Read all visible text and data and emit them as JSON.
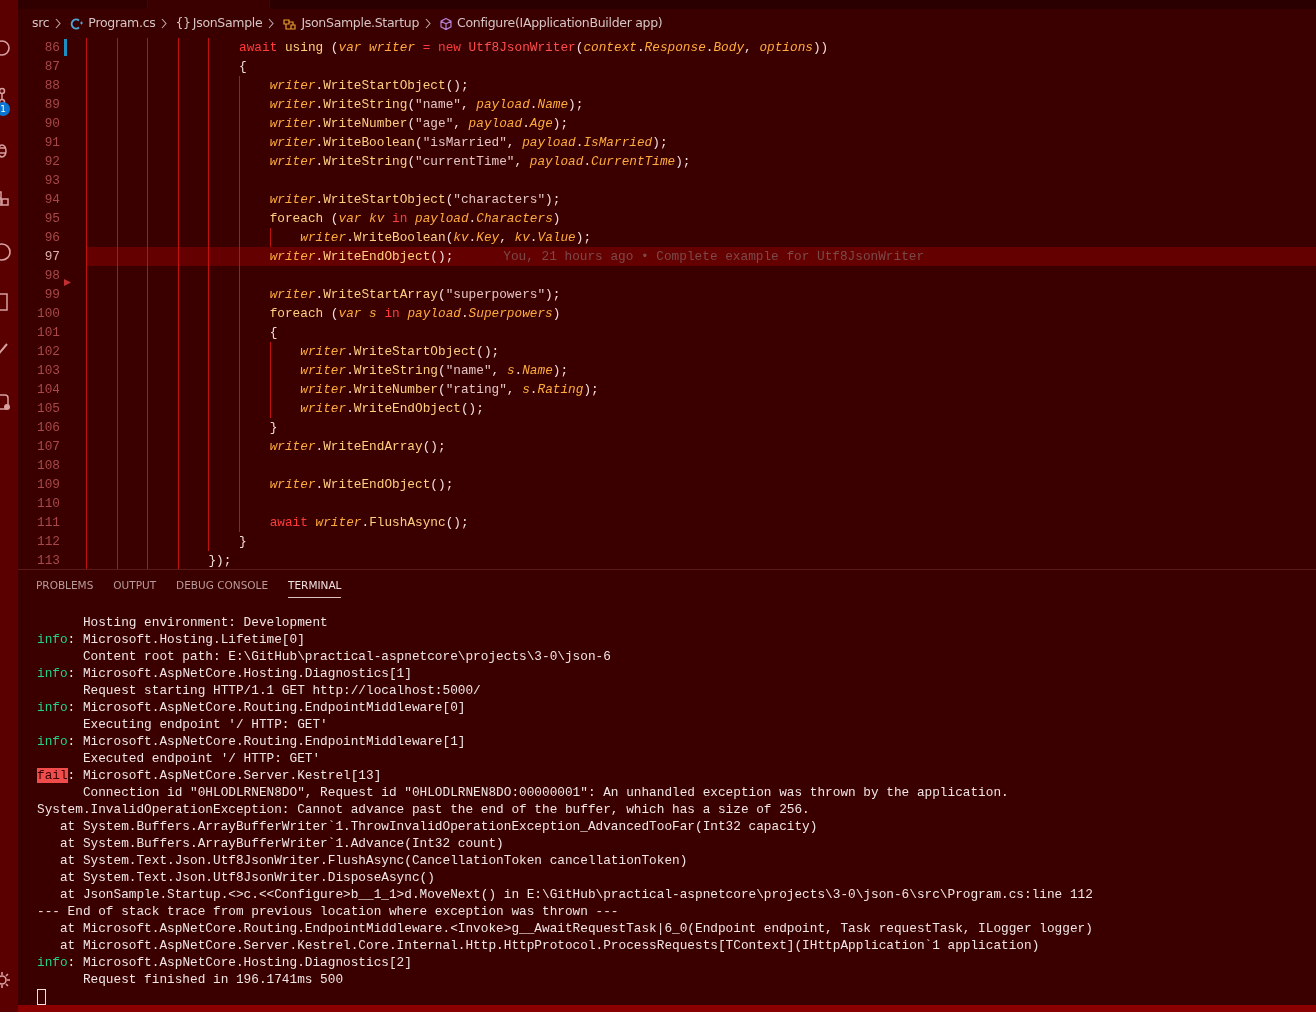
{
  "activity_bar": {
    "badge": "1"
  },
  "breadcrumb": [
    {
      "kind": "folder",
      "label": "src"
    },
    {
      "kind": "csharp",
      "label": "Program.cs"
    },
    {
      "kind": "namespace",
      "symbol": "{}",
      "label": "JsonSample"
    },
    {
      "kind": "class",
      "label": "JsonSample.Startup"
    },
    {
      "kind": "method",
      "label": "Configure(IApplicationBuilder app)"
    }
  ],
  "editor": {
    "lines": [
      {
        "number": "86",
        "modified": true,
        "current": false,
        "tokens": [
          {
            "kind": "kw",
            "text": "                    await "
          },
          {
            "kind": "ctl",
            "text": "using"
          },
          {
            "kind": "p",
            "text": " ("
          },
          {
            "kind": "var",
            "text": "var writer"
          },
          {
            "kind": "kw",
            "text": " = new "
          },
          {
            "kind": "type",
            "text": "Utf8JsonWriter"
          },
          {
            "kind": "p",
            "text": "("
          },
          {
            "kind": "var",
            "text": "context"
          },
          {
            "kind": "p",
            "text": "."
          },
          {
            "kind": "var",
            "text": "Response"
          },
          {
            "kind": "p",
            "text": "."
          },
          {
            "kind": "var",
            "text": "Body"
          },
          {
            "kind": "p",
            "text": ", "
          },
          {
            "kind": "var",
            "text": "options"
          },
          {
            "kind": "p",
            "text": "))"
          }
        ]
      },
      {
        "number": "87",
        "modified": false,
        "current": false,
        "tokens": [
          {
            "kind": "p",
            "text": "                    {"
          }
        ]
      },
      {
        "number": "88",
        "modified": false,
        "current": false,
        "tokens": [
          {
            "kind": "var",
            "text": "                        writer"
          },
          {
            "kind": "p",
            "text": "."
          },
          {
            "kind": "fn",
            "text": "WriteStartObject"
          },
          {
            "kind": "p",
            "text": "();"
          }
        ]
      },
      {
        "number": "89",
        "modified": false,
        "current": false,
        "tokens": [
          {
            "kind": "var",
            "text": "                        writer"
          },
          {
            "kind": "p",
            "text": "."
          },
          {
            "kind": "fn",
            "text": "WriteString"
          },
          {
            "kind": "p",
            "text": "("
          },
          {
            "kind": "str",
            "text": "\"name\""
          },
          {
            "kind": "p",
            "text": ", "
          },
          {
            "kind": "var",
            "text": "payload"
          },
          {
            "kind": "p",
            "text": "."
          },
          {
            "kind": "var",
            "text": "Name"
          },
          {
            "kind": "p",
            "text": ");"
          }
        ]
      },
      {
        "number": "90",
        "modified": false,
        "current": false,
        "tokens": [
          {
            "kind": "var",
            "text": "                        writer"
          },
          {
            "kind": "p",
            "text": "."
          },
          {
            "kind": "fn",
            "text": "WriteNumber"
          },
          {
            "kind": "p",
            "text": "("
          },
          {
            "kind": "str",
            "text": "\"age\""
          },
          {
            "kind": "p",
            "text": ", "
          },
          {
            "kind": "var",
            "text": "payload"
          },
          {
            "kind": "p",
            "text": "."
          },
          {
            "kind": "var",
            "text": "Age"
          },
          {
            "kind": "p",
            "text": ");"
          }
        ]
      },
      {
        "number": "91",
        "modified": false,
        "current": false,
        "tokens": [
          {
            "kind": "var",
            "text": "                        writer"
          },
          {
            "kind": "p",
            "text": "."
          },
          {
            "kind": "fn",
            "text": "WriteBoolean"
          },
          {
            "kind": "p",
            "text": "("
          },
          {
            "kind": "str",
            "text": "\"isMarried\""
          },
          {
            "kind": "p",
            "text": ", "
          },
          {
            "kind": "var",
            "text": "payload"
          },
          {
            "kind": "p",
            "text": "."
          },
          {
            "kind": "var",
            "text": "IsMarried"
          },
          {
            "kind": "p",
            "text": ");"
          }
        ]
      },
      {
        "number": "92",
        "modified": false,
        "current": false,
        "tokens": [
          {
            "kind": "var",
            "text": "                        writer"
          },
          {
            "kind": "p",
            "text": "."
          },
          {
            "kind": "fn",
            "text": "WriteString"
          },
          {
            "kind": "p",
            "text": "("
          },
          {
            "kind": "str",
            "text": "\"currentTime\""
          },
          {
            "kind": "p",
            "text": ", "
          },
          {
            "kind": "var",
            "text": "payload"
          },
          {
            "kind": "p",
            "text": "."
          },
          {
            "kind": "var",
            "text": "CurrentTime"
          },
          {
            "kind": "p",
            "text": ");"
          }
        ]
      },
      {
        "number": "93",
        "modified": false,
        "current": false
      },
      {
        "number": "94",
        "modified": false,
        "current": false,
        "tokens": [
          {
            "kind": "var",
            "text": "                        writer"
          },
          {
            "kind": "p",
            "text": "."
          },
          {
            "kind": "fn",
            "text": "WriteStartObject"
          },
          {
            "kind": "p",
            "text": "("
          },
          {
            "kind": "str",
            "text": "\"characters\""
          },
          {
            "kind": "p",
            "text": ");"
          }
        ]
      },
      {
        "number": "95",
        "modified": false,
        "current": false,
        "tokens": [
          {
            "kind": "ctl",
            "text": "                        foreach"
          },
          {
            "kind": "p",
            "text": " ("
          },
          {
            "kind": "var",
            "text": "var kv"
          },
          {
            "kind": "kw",
            "text": " in "
          },
          {
            "kind": "var",
            "text": "payload"
          },
          {
            "kind": "p",
            "text": "."
          },
          {
            "kind": "var",
            "text": "Characters"
          },
          {
            "kind": "p",
            "text": ")"
          }
        ]
      },
      {
        "number": "96",
        "modified": false,
        "current": false,
        "tokens": [
          {
            "kind": "var",
            "text": "                            writer"
          },
          {
            "kind": "p",
            "text": "."
          },
          {
            "kind": "fn",
            "text": "WriteBoolean"
          },
          {
            "kind": "p",
            "text": "("
          },
          {
            "kind": "var",
            "text": "kv"
          },
          {
            "kind": "p",
            "text": "."
          },
          {
            "kind": "var",
            "text": "Key"
          },
          {
            "kind": "p",
            "text": ", "
          },
          {
            "kind": "var",
            "text": "kv"
          },
          {
            "kind": "p",
            "text": "."
          },
          {
            "kind": "var",
            "text": "Value"
          },
          {
            "kind": "p",
            "text": ");"
          }
        ]
      },
      {
        "number": "97",
        "modified": false,
        "current": true,
        "blame": "You, 21 hours ago • Complete example for Utf8JsonWriter",
        "tokens": [
          {
            "kind": "var",
            "text": "                        writer"
          },
          {
            "kind": "p",
            "text": "."
          },
          {
            "kind": "fn",
            "text": "WriteEndObject"
          },
          {
            "kind": "p",
            "text": "();"
          }
        ]
      },
      {
        "number": "98",
        "modified": false,
        "current": false
      },
      {
        "number": "99",
        "modified": false,
        "deleted_above": true,
        "current": false,
        "tokens": [
          {
            "kind": "var",
            "text": "                        writer"
          },
          {
            "kind": "p",
            "text": "."
          },
          {
            "kind": "fn",
            "text": "WriteStartArray"
          },
          {
            "kind": "p",
            "text": "("
          },
          {
            "kind": "str",
            "text": "\"superpowers\""
          },
          {
            "kind": "p",
            "text": ");"
          }
        ]
      },
      {
        "number": "100",
        "modified": false,
        "current": false,
        "tokens": [
          {
            "kind": "ctl",
            "text": "                        foreach"
          },
          {
            "kind": "p",
            "text": " ("
          },
          {
            "kind": "var",
            "text": "var s"
          },
          {
            "kind": "kw",
            "text": " in "
          },
          {
            "kind": "var",
            "text": "payload"
          },
          {
            "kind": "p",
            "text": "."
          },
          {
            "kind": "var",
            "text": "Superpowers"
          },
          {
            "kind": "p",
            "text": ")"
          }
        ]
      },
      {
        "number": "101",
        "modified": false,
        "current": false,
        "tokens": [
          {
            "kind": "p",
            "text": "                        {"
          }
        ]
      },
      {
        "number": "102",
        "modified": false,
        "current": false,
        "tokens": [
          {
            "kind": "var",
            "text": "                            writer"
          },
          {
            "kind": "p",
            "text": "."
          },
          {
            "kind": "fn",
            "text": "WriteStartObject"
          },
          {
            "kind": "p",
            "text": "();"
          }
        ]
      },
      {
        "number": "103",
        "modified": false,
        "current": false,
        "tokens": [
          {
            "kind": "var",
            "text": "                            writer"
          },
          {
            "kind": "p",
            "text": "."
          },
          {
            "kind": "fn",
            "text": "WriteString"
          },
          {
            "kind": "p",
            "text": "("
          },
          {
            "kind": "str",
            "text": "\"name\""
          },
          {
            "kind": "p",
            "text": ", "
          },
          {
            "kind": "var",
            "text": "s"
          },
          {
            "kind": "p",
            "text": "."
          },
          {
            "kind": "var",
            "text": "Name"
          },
          {
            "kind": "p",
            "text": ");"
          }
        ]
      },
      {
        "number": "104",
        "modified": false,
        "current": false,
        "tokens": [
          {
            "kind": "var",
            "text": "                            writer"
          },
          {
            "kind": "p",
            "text": "."
          },
          {
            "kind": "fn",
            "text": "WriteNumber"
          },
          {
            "kind": "p",
            "text": "("
          },
          {
            "kind": "str",
            "text": "\"rating\""
          },
          {
            "kind": "p",
            "text": ", "
          },
          {
            "kind": "var",
            "text": "s"
          },
          {
            "kind": "p",
            "text": "."
          },
          {
            "kind": "var",
            "text": "Rating"
          },
          {
            "kind": "p",
            "text": ");"
          }
        ]
      },
      {
        "number": "105",
        "modified": false,
        "current": false,
        "tokens": [
          {
            "kind": "var",
            "text": "                            writer"
          },
          {
            "kind": "p",
            "text": "."
          },
          {
            "kind": "fn",
            "text": "WriteEndObject"
          },
          {
            "kind": "p",
            "text": "();"
          }
        ]
      },
      {
        "number": "106",
        "modified": false,
        "current": false,
        "tokens": [
          {
            "kind": "p",
            "text": "                        }"
          }
        ]
      },
      {
        "number": "107",
        "modified": false,
        "current": false,
        "tokens": [
          {
            "kind": "var",
            "text": "                        writer"
          },
          {
            "kind": "p",
            "text": "."
          },
          {
            "kind": "fn",
            "text": "WriteEndArray"
          },
          {
            "kind": "p",
            "text": "();"
          }
        ]
      },
      {
        "number": "108",
        "modified": false,
        "current": false
      },
      {
        "number": "109",
        "modified": false,
        "current": false,
        "tokens": [
          {
            "kind": "var",
            "text": "                        writer"
          },
          {
            "kind": "p",
            "text": "."
          },
          {
            "kind": "fn",
            "text": "WriteEndObject"
          },
          {
            "kind": "p",
            "text": "();"
          }
        ]
      },
      {
        "number": "110",
        "modified": false,
        "current": false
      },
      {
        "number": "111",
        "modified": false,
        "current": false,
        "tokens": [
          {
            "kind": "kw",
            "text": "                        await "
          },
          {
            "kind": "var",
            "text": "writer"
          },
          {
            "kind": "p",
            "text": "."
          },
          {
            "kind": "fn",
            "text": "FlushAsync"
          },
          {
            "kind": "p",
            "text": "();"
          }
        ]
      },
      {
        "number": "112",
        "modified": false,
        "current": false,
        "tokens": [
          {
            "kind": "p",
            "text": "                    }"
          }
        ]
      },
      {
        "number": "113",
        "modified": false,
        "current": false,
        "tokens": [
          {
            "kind": "p",
            "text": "                });"
          }
        ]
      }
    ]
  },
  "panel": {
    "tabs": [
      {
        "label": "PROBLEMS",
        "selected": false
      },
      {
        "label": "OUTPUT",
        "selected": false
      },
      {
        "label": "DEBUG CONSOLE",
        "selected": false
      },
      {
        "label": "TERMINAL",
        "selected": true
      }
    ],
    "terminal": [
      {
        "text": "      Hosting environment: Development"
      },
      {
        "kind": "info",
        "tag": "info",
        "text": ": Microsoft.Hosting.Lifetime[0]"
      },
      {
        "text": "      Content root path: E:\\GitHub\\practical-aspnetcore\\projects\\3-0\\json-6"
      },
      {
        "kind": "info",
        "tag": "info",
        "text": ": Microsoft.AspNetCore.Hosting.Diagnostics[1]"
      },
      {
        "text": "      Request starting HTTP/1.1 GET http://localhost:5000/"
      },
      {
        "kind": "info",
        "tag": "info",
        "text": ": Microsoft.AspNetCore.Routing.EndpointMiddleware[0]"
      },
      {
        "text": "      Executing endpoint '/ HTTP: GET'"
      },
      {
        "kind": "info",
        "tag": "info",
        "text": ": Microsoft.AspNetCore.Routing.EndpointMiddleware[1]"
      },
      {
        "text": "      Executed endpoint '/ HTTP: GET'"
      },
      {
        "kind": "fail",
        "tag": "fail",
        "text": ": Microsoft.AspNetCore.Server.Kestrel[13]"
      },
      {
        "text": "      Connection id \"0HLODLRNEN8DO\", Request id \"0HLODLRNEN8DO:00000001\": An unhandled exception was thrown by the application."
      },
      {
        "text": "System.InvalidOperationException: Cannot advance past the end of the buffer, which has a size of 256."
      },
      {
        "text": "   at System.Buffers.ArrayBufferWriter`1.ThrowInvalidOperationException_AdvancedTooFar(Int32 capacity)"
      },
      {
        "text": "   at System.Buffers.ArrayBufferWriter`1.Advance(Int32 count)"
      },
      {
        "text": "   at System.Text.Json.Utf8JsonWriter.FlushAsync(CancellationToken cancellationToken)"
      },
      {
        "text": "   at System.Text.Json.Utf8JsonWriter.DisposeAsync()"
      },
      {
        "text": "   at JsonSample.Startup.<>c.<<Configure>b__1_1>d.MoveNext() in E:\\GitHub\\practical-aspnetcore\\projects\\3-0\\json-6\\src\\Program.cs:line 112"
      },
      {
        "text": "--- End of stack trace from previous location where exception was thrown ---"
      },
      {
        "text": "   at Microsoft.AspNetCore.Routing.EndpointMiddleware.<Invoke>g__AwaitRequestTask|6_0(Endpoint endpoint, Task requestTask, ILogger logger)"
      },
      {
        "text": "   at Microsoft.AspNetCore.Server.Kestrel.Core.Internal.Http.HttpProtocol.ProcessRequests[TContext](IHttpApplication`1 application)"
      },
      {
        "kind": "info",
        "tag": "info",
        "text": ": Microsoft.AspNetCore.Hosting.Diagnostics[2]"
      },
      {
        "text": "      Request finished in 196.1741ms 500"
      }
    ]
  }
}
